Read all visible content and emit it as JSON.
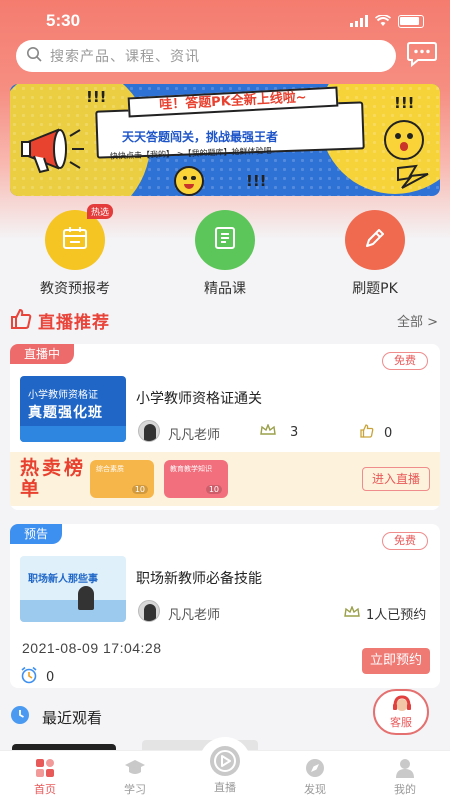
{
  "status_bar": {
    "time": "5:30"
  },
  "search": {
    "placeholder": "搜索产品、课程、资讯"
  },
  "banner": {
    "title": "哇！答题PK全新上线啦~",
    "subtitle": "天天答题闯关，挑战最强王者",
    "hint": "快快点击【我的】->【我的题库】抢鲜体验吧",
    "exclaim": "!!!"
  },
  "quick_entries": [
    {
      "label": "教资预报考",
      "badge": "热选",
      "color": "#f5c524",
      "icon": "calendar-icon"
    },
    {
      "label": "精品课",
      "color": "#5dc65a",
      "icon": "book-icon"
    },
    {
      "label": "刷题PK",
      "color": "#f06a50",
      "icon": "pencil-icon"
    }
  ],
  "live_section": {
    "title": "直播推荐",
    "more": "全部 >"
  },
  "live_card": {
    "tag": "直播中",
    "free": "免费",
    "thumb_top": "小学教师资格证",
    "thumb_main": "真题强化班",
    "title": "小学教师资格证通关",
    "teacher": "凡凡老师",
    "views": "3",
    "likes": "0",
    "hot_list": "热卖榜单",
    "mini_cards": [
      {
        "label": "综合素质",
        "price": "10"
      },
      {
        "label": "教育教学知识",
        "price": "10"
      }
    ],
    "enter": "进入直播"
  },
  "preview_card": {
    "tag": "预告",
    "free": "免费",
    "thumb_text": "职场新人那些事",
    "title": "职场新教师必备技能",
    "teacher": "凡凡老师",
    "booked": "1人已预约",
    "date": "2021-08-09 17:04:28",
    "count": "0",
    "reserve": "立即预约"
  },
  "recent": {
    "title": "最近观看"
  },
  "service": {
    "label": "客服"
  },
  "tabs": [
    {
      "label": "首页",
      "active": true
    },
    {
      "label": "学习",
      "active": false
    },
    {
      "label": "直播",
      "active": false
    },
    {
      "label": "发现",
      "active": false
    },
    {
      "label": "我的",
      "active": false
    }
  ]
}
